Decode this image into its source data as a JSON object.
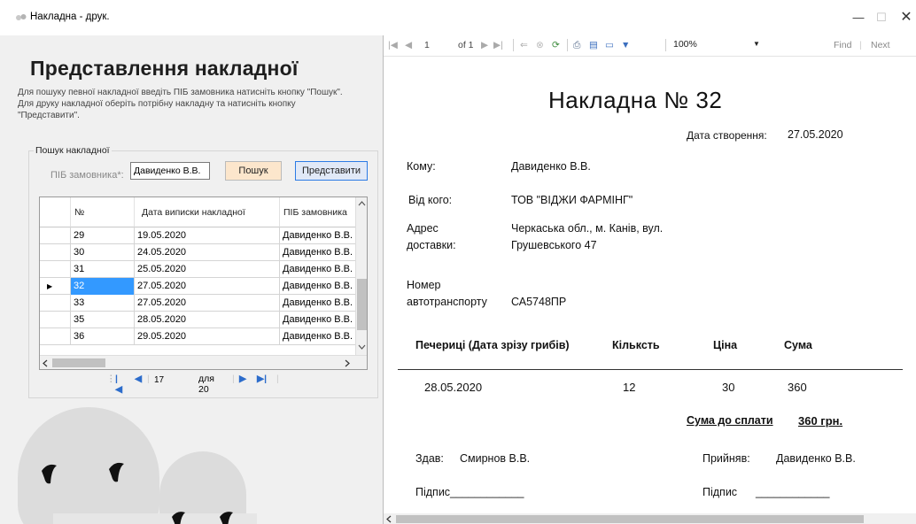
{
  "window": {
    "title": "Накладна - друк.",
    "min": "—",
    "max": "☐",
    "close": "✕"
  },
  "left": {
    "heading": "Представлення накладної",
    "intro": "Для пошуку певної накладної введіть ПІБ замовника натисніть кнопку \"Пошук\". Для друку накладної оберіть потрібну накладну та натисніть кнопку \"Представити\".",
    "group_legend": "Пошук накладної",
    "fio_label": "ПІБ замовника*:",
    "fio_value": "Давиденко В.В.",
    "search_btn": "Пошук",
    "present_btn": "Представити"
  },
  "grid": {
    "columns": [
      "№",
      "Дата виписки накладної",
      "ПІБ замовника"
    ],
    "rows": [
      {
        "num": "29",
        "date": "19.05.2020",
        "client": "Давиденко В.В.",
        "selected": false
      },
      {
        "num": "30",
        "date": "24.05.2020",
        "client": "Давиденко В.В.",
        "selected": false
      },
      {
        "num": "31",
        "date": "25.05.2020",
        "client": "Давиденко В.В.",
        "selected": false
      },
      {
        "num": "32",
        "date": "27.05.2020",
        "client": "Давиденко В.В.",
        "selected": true
      },
      {
        "num": "33",
        "date": "27.05.2020",
        "client": "Давиденко В.В.",
        "selected": false
      },
      {
        "num": "35",
        "date": "28.05.2020",
        "client": "Давиденко В.В.",
        "selected": false
      },
      {
        "num": "36",
        "date": "29.05.2020",
        "client": "Давиденко В.В.",
        "selected": false
      }
    ]
  },
  "navigator": {
    "position": "17",
    "of": "для 20"
  },
  "report_toolbar": {
    "page": "1",
    "of_pages": "of 1",
    "zoom": "100%",
    "find": "Find",
    "next": "Next"
  },
  "report": {
    "title": "Накладна  № 32",
    "created_label": "Дата створення:",
    "created_value": "27.05.2020",
    "to_label": "Кому:",
    "to_value": "Давиденко В.В.",
    "from_label": "Від кого:",
    "from_value": "ТОВ \"ВІДЖИ ФАРМІНГ\"",
    "address_label_1": "Адрес",
    "address_label_2": "доставки:",
    "address_value_1": "Черкаська обл., м. Канів, вул.",
    "address_value_2": "Грушевського 47",
    "vehicle_label_1": "Номер",
    "vehicle_label_2": "автотранспорту",
    "vehicle_value": "СА5748ПР",
    "col_product": "Печериці (Дата зрізу грибів)",
    "col_qty": "Кільксть",
    "col_price": "Ціна",
    "col_sum": "Сума",
    "row_date": "28.05.2020",
    "row_qty": "12",
    "row_price": "30",
    "row_sum": "360",
    "total_label": "Сума до сплати",
    "total_value": "360 грн.",
    "gave_label": "Здав:",
    "gave_value": "Смирнов В.В.",
    "received_label": "Прийняв:",
    "received_value": "Давиденко В.В.",
    "sign_left": "Підпис____________",
    "sign_right_label": "Підпис",
    "sign_right_line": "____________"
  }
}
